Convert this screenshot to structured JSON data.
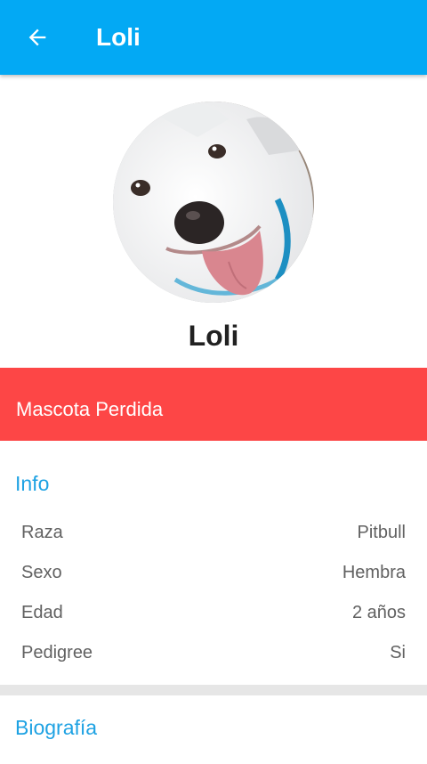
{
  "appbar": {
    "title": "Loli",
    "back_icon": "arrow-left-icon",
    "color": "#03a9f4"
  },
  "profile": {
    "name": "Loli",
    "photo": "dog-photo"
  },
  "status": {
    "label": "Mascota Perdida",
    "color": "#fd4646"
  },
  "info": {
    "title": "Info",
    "rows": [
      {
        "label": "Raza",
        "value": "Pitbull"
      },
      {
        "label": "Sexo",
        "value": "Hembra"
      },
      {
        "label": "Edad",
        "value": "2 años"
      },
      {
        "label": "Pedigree",
        "value": "Si"
      }
    ]
  },
  "bio": {
    "title": "Biografía",
    "text": ""
  }
}
